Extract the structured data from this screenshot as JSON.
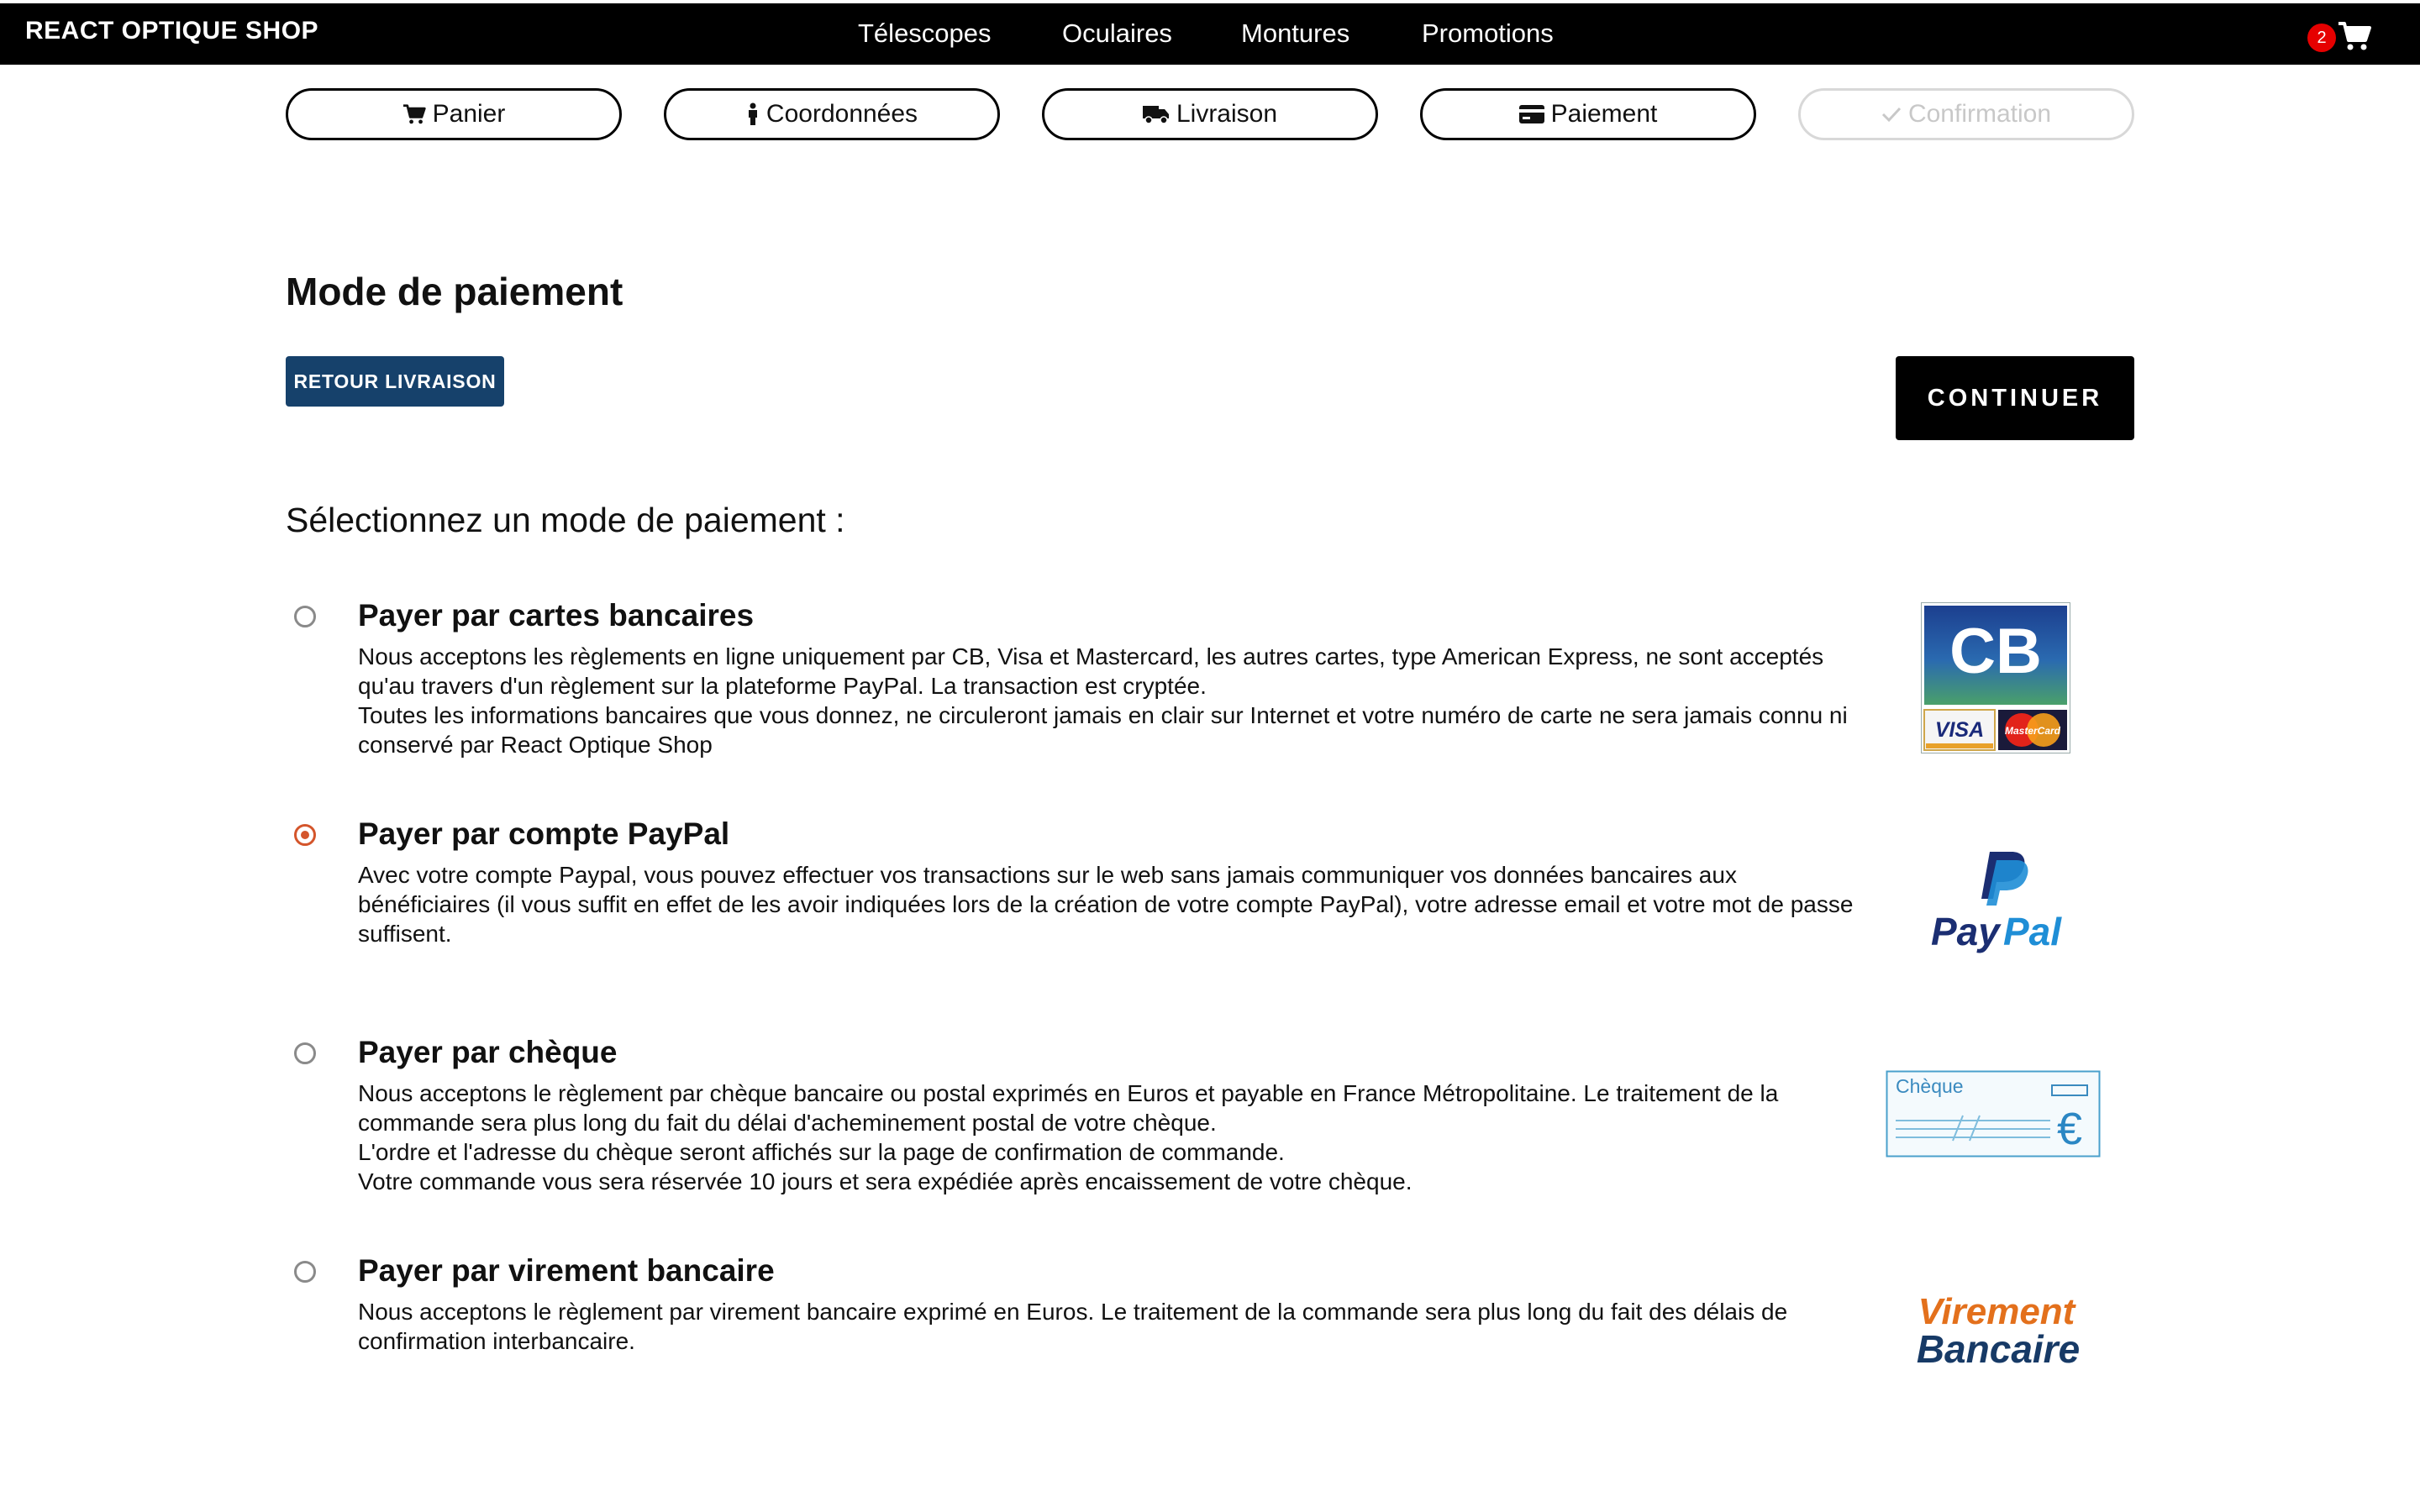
{
  "brand": "REACT OPTIQUE SHOP",
  "nav": [
    "Télescopes",
    "Oculaires",
    "Montures",
    "Promotions"
  ],
  "cart": {
    "count": "2",
    "icon": "cart-icon"
  },
  "steps": [
    {
      "label": "Panier",
      "icon": "cart-icon",
      "state": "done"
    },
    {
      "label": "Coordonnées",
      "icon": "person-icon",
      "state": "done"
    },
    {
      "label": "Livraison",
      "icon": "truck-icon",
      "state": "done"
    },
    {
      "label": "Paiement",
      "icon": "credit-card-icon",
      "state": "active"
    },
    {
      "label": "Confirmation",
      "icon": "check-icon",
      "state": "disabled"
    }
  ],
  "page": {
    "title": "Mode de paiement",
    "back_label": "RETOUR LIVRAISON",
    "continue_label": "CONTINUER",
    "select_heading": "Sélectionnez un mode de paiement :"
  },
  "options": [
    {
      "title": "Payer par cartes bancaires",
      "checked": false,
      "lines": [
        "Nous acceptons les règlements en ligne uniquement par CB, Visa et Mastercard, les autres cartes, type American Express, ne sont acceptés qu'au travers d'un règlement sur la plateforme PayPal. La transaction est cryptée.",
        "Toutes les informations bancaires que vous donnez, ne circuleront jamais en clair sur Internet et votre numéro de carte ne sera jamais connu ni conservé par React Optique Shop"
      ],
      "logo": {
        "main": "CB",
        "sub1": "VISA",
        "sub2": "MasterCard"
      }
    },
    {
      "title": "Payer par compte PayPal",
      "checked": true,
      "lines": [
        "Avec votre compte Paypal, vous pouvez effectuer vos transactions sur le web sans jamais communiquer vos données bancaires aux bénéficiaires (il vous suffit en effet de les avoir indiquées lors de la création de votre compte PayPal), votre adresse email et votre mot de passe suffisent."
      ],
      "logo": {
        "part1": "Pay",
        "part2": "Pal"
      }
    },
    {
      "title": "Payer par chèque",
      "checked": false,
      "lines": [
        "Nous acceptons le règlement par chèque bancaire ou postal exprimés en Euros et payable en France Métropolitaine. Le traitement de la commande sera plus long du fait du délai d'acheminement postal de votre chèque.",
        "L'ordre et l'adresse du chèque seront affichés sur la page de confirmation de commande.",
        "Votre commande vous sera réservée 10 jours et sera expédiée après encaissement de votre chèque."
      ],
      "logo": {
        "label": "Chèque",
        "symbol": "€"
      }
    },
    {
      "title": "Payer par virement bancaire",
      "checked": false,
      "lines": [
        "Nous acceptons le règlement par virement bancaire exprimé en Euros. Le traitement de la commande sera plus long du fait des délais de confirmation interbancaire."
      ],
      "logo": {
        "line1": "Virement",
        "line2": "Bancaire"
      }
    }
  ],
  "colors": {
    "nav_bg": "#000000",
    "back_button": "#16416b",
    "continue_button": "#000000",
    "radio_checked": "#d4552b",
    "cart_badge": "#e60000"
  }
}
